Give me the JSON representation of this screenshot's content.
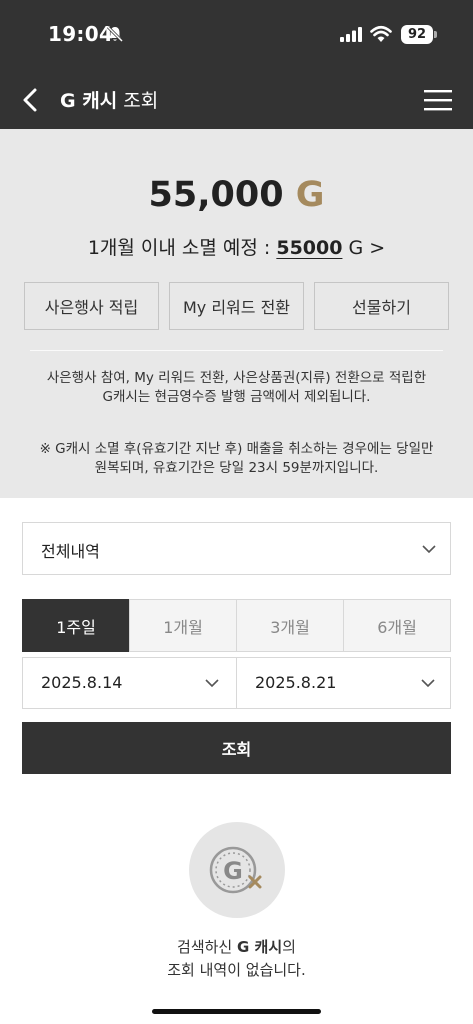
{
  "status_bar": {
    "time": "19:04",
    "battery": "92"
  },
  "nav": {
    "title_brand": "G 캐시",
    "title_rest": " 조회"
  },
  "summary": {
    "amount": "55,000",
    "amount_unit": "G",
    "expire_prefix": "1개월 이내 소멸 예정 : ",
    "expire_value": "55000",
    "expire_suffix": " G >",
    "actions": [
      "사은행사 적립",
      "My 리워드 전환",
      "선물하기"
    ],
    "note1": "사은행사 참여, My 리워드 전환, 사은상품권(지류) 전환으로 적립한 G캐시는 현금영수증 발행 금액에서 제외됩니다.",
    "note2": "※ G캐시 소멸 후(유효기간 지난 후) 매출을 취소하는 경우에는 당일만 원복되며, 유효기간은 당일 23시 59분까지입니다."
  },
  "filter": {
    "selected": "전체내역"
  },
  "periods": [
    "1주일",
    "1개월",
    "3개월",
    "6개월"
  ],
  "active_period": "1주일",
  "dates": {
    "start": "2025.8.14",
    "end": "2025.8.21"
  },
  "search_button": "조회",
  "empty": {
    "line1_prefix": "검색하신 ",
    "line1_brand": "G 캐시",
    "line1_suffix": "의",
    "line2": "조회 내역이 없습니다."
  },
  "colors": {
    "dark": "#333333",
    "gold": "#a58a5e",
    "summary_bg": "#e8e8e8"
  }
}
